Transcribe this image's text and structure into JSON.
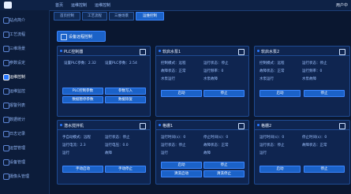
{
  "topbar": {
    "breadcrumb": [
      "首页",
      "运维控制",
      "运维控制"
    ],
    "user": "用户中"
  },
  "tabs": [
    {
      "label": "首页控制",
      "active": false
    },
    {
      "label": "工艺流程",
      "active": false
    },
    {
      "label": "三维场景",
      "active": false
    },
    {
      "label": "运维控制",
      "active": true
    }
  ],
  "sidebar": {
    "items": [
      {
        "label": "站点简介",
        "active": false
      },
      {
        "label": "工艺流程",
        "active": false
      },
      {
        "label": "三维场景",
        "active": false
      },
      {
        "label": "参数设定",
        "active": false
      },
      {
        "label": "运维控制",
        "active": true
      },
      {
        "label": "运维监控",
        "active": false
      },
      {
        "label": "报警列表",
        "active": false
      },
      {
        "label": "数据统计",
        "active": false
      },
      {
        "label": "日志记录",
        "active": false
      },
      {
        "label": "运营管理",
        "active": false
      },
      {
        "label": "设备管理",
        "active": false
      },
      {
        "label": "摄像头管理",
        "active": false
      }
    ]
  },
  "section": {
    "title": "设备远程控制"
  },
  "cards": [
    {
      "title": "PLC控制器",
      "rows": [
        "设置PLC参数：2.32",
        "设置PLC参数：2.54"
      ],
      "buttons": [
        "PLC控制参数",
        "参数写入",
        "数据暂停参数",
        "数据恢复"
      ]
    },
    {
      "title": "软启水泵1",
      "rows": [
        "控制模式：远程",
        "运行状态：停止",
        "故障状态：正常",
        "运行频率：0",
        "水泵运行",
        "水泵故障"
      ],
      "buttons": [
        "启动",
        "停止"
      ]
    },
    {
      "title": "软启水泵2",
      "rows": [
        "控制模式：远程",
        "运行状态：停止",
        "故障状态：正常",
        "运行频率：0",
        "水泵运行",
        "水泵故障"
      ],
      "buttons": [
        "启动",
        "停止"
      ]
    },
    {
      "title": "潜水搅拌机",
      "rows": [
        "手自动模式：远程",
        "运行状态：停止",
        "运行电流：2.3",
        "运行电压：0.0",
        "运行",
        "故障"
      ],
      "buttons": [
        "手动启动",
        "手动停止"
      ]
    },
    {
      "title": "格栅1",
      "rows": [
        "运行时间(s)：0",
        "停止时间(s)：0",
        "运行状态：停止",
        "故障状态：正常",
        "运行",
        "故障"
      ],
      "buttons": [
        "启动",
        "停止",
        "清洗启动",
        "清洗停止"
      ]
    },
    {
      "title": "格栅2",
      "rows": [
        "运行时间(s)：0",
        "停止时间(s)：0",
        "运行状态：停止",
        "故障状态：正常",
        "运行"
      ],
      "buttons": [
        "启动",
        "停止"
      ]
    }
  ]
}
